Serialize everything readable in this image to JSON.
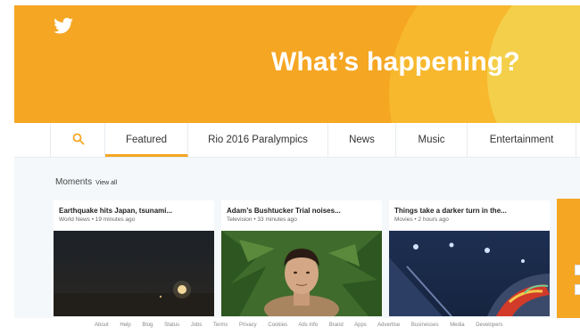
{
  "hero": {
    "title": "What’s happening?",
    "background_color": "#f5a623"
  },
  "nav": {
    "search_icon": "search-icon",
    "tabs": [
      {
        "label": "Featured",
        "active": true
      },
      {
        "label": "Rio 2016 Paralympics",
        "active": false
      },
      {
        "label": "News",
        "active": false
      },
      {
        "label": "Music",
        "active": false
      },
      {
        "label": "Entertainment",
        "active": false
      }
    ]
  },
  "moments": {
    "title": "Moments",
    "view_all": "View all",
    "cards": [
      {
        "title": "Earthquake hits Japan, tsunami...",
        "meta": "World News • 19 minutes ago"
      },
      {
        "title": "Adam’s Bushtucker Trial noises...",
        "meta": "Television • 33 minutes ago"
      },
      {
        "title": "Things take a darker turn in the...",
        "meta": "Movies • 2 hours ago"
      }
    ]
  },
  "footer": {
    "links": [
      "About",
      "Help",
      "Blog",
      "Status",
      "Jobs",
      "Terms",
      "Privacy",
      "Cookies",
      "Ads info",
      "Brand",
      "Apps",
      "Advertise",
      "Businesses",
      "Media",
      "Developers"
    ]
  },
  "colors": {
    "accent": "#f5a623",
    "page_bg": "#f5f8fa"
  }
}
